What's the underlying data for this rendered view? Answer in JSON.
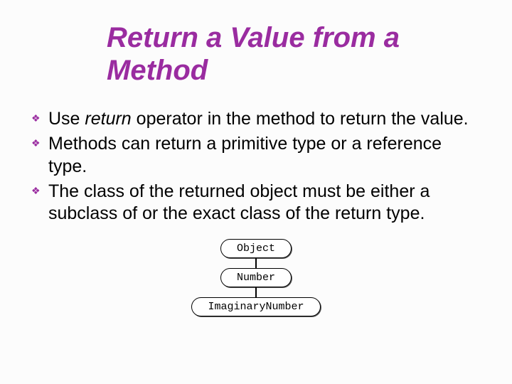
{
  "title": "Return a Value from a Method",
  "bullets": [
    {
      "pre": "Use ",
      "em": "return",
      "post": " operator in the method to return the value."
    },
    {
      "pre": "Methods can return a primitive type or a reference type.",
      "em": "",
      "post": ""
    },
    {
      "pre": "The class of the returned object must be either a subclass of or the exact class of the return type.",
      "em": "",
      "post": ""
    }
  ],
  "diagram": {
    "nodes": [
      "Object",
      "Number",
      "ImaginaryNumber"
    ]
  }
}
